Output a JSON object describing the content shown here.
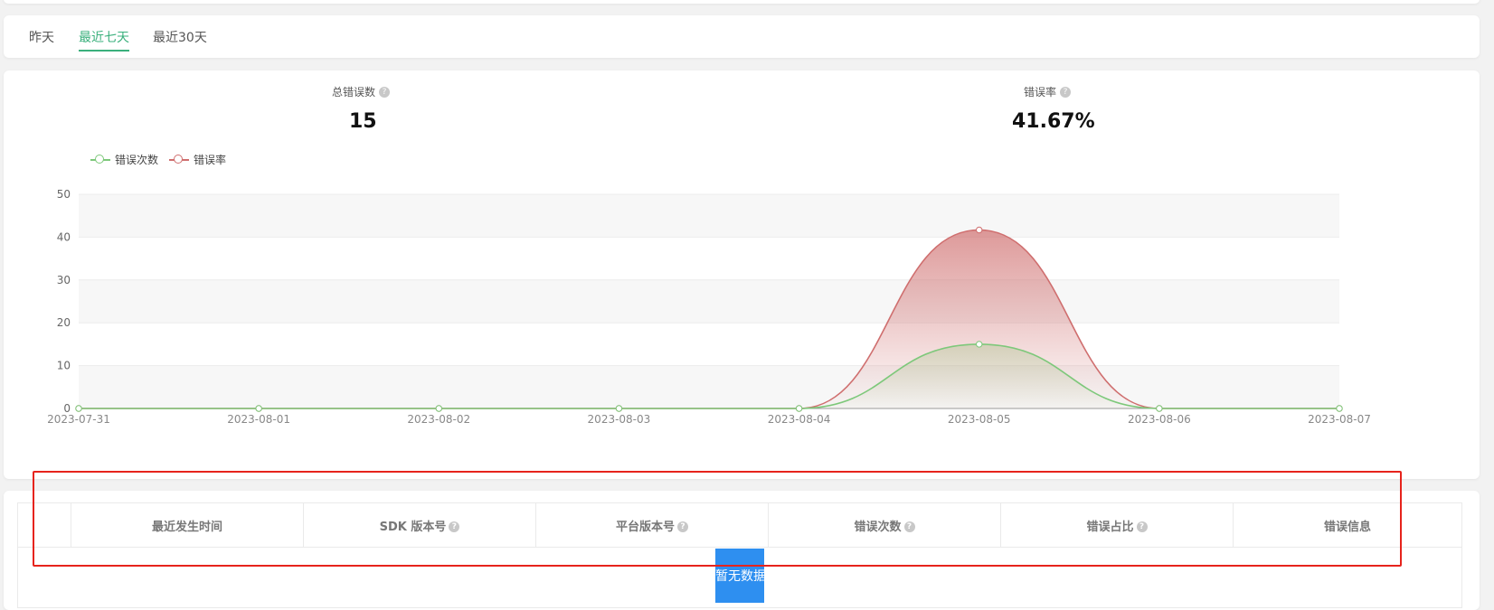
{
  "tabs": [
    {
      "label": "昨天",
      "active": false
    },
    {
      "label": "最近七天",
      "active": true
    },
    {
      "label": "最近30天",
      "active": false
    }
  ],
  "stats": {
    "total_errors_label": "总错误数",
    "total_errors_value": "15",
    "error_rate_label": "错误率",
    "error_rate_value": "41.67%"
  },
  "legend": [
    {
      "label": "错误次数",
      "color": "#7dc87a"
    },
    {
      "label": "错误率",
      "color": "#cf6e6e"
    }
  ],
  "chart_data": {
    "type": "area",
    "x": [
      "2023-07-31",
      "2023-08-01",
      "2023-08-02",
      "2023-08-03",
      "2023-08-04",
      "2023-08-05",
      "2023-08-06",
      "2023-08-07"
    ],
    "ylim": [
      0,
      50
    ],
    "yticks": [
      0,
      10,
      20,
      30,
      40,
      50
    ],
    "series": [
      {
        "name": "错误次数",
        "values": [
          0,
          0,
          0,
          0,
          0,
          15,
          0,
          0
        ],
        "color": "#7dc87a"
      },
      {
        "name": "错误率",
        "values": [
          0,
          0,
          0,
          0,
          0,
          41.67,
          0,
          0
        ],
        "color": "#cf6e6e"
      }
    ],
    "grid": true,
    "legend_position": "top-left"
  },
  "table": {
    "columns": [
      {
        "label": "",
        "help": false
      },
      {
        "label": "最近发生时间",
        "help": false
      },
      {
        "label": "SDK 版本号",
        "help": true
      },
      {
        "label": "平台版本号",
        "help": true
      },
      {
        "label": "错误次数",
        "help": true
      },
      {
        "label": "错误占比",
        "help": true
      },
      {
        "label": "错误信息",
        "help": false
      }
    ],
    "empty_text": "暂无数据"
  },
  "help_icon_glyph": "?"
}
